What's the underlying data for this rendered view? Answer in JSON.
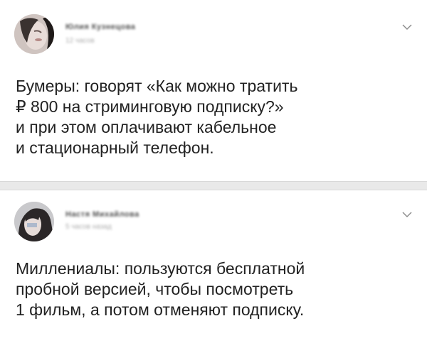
{
  "posts": [
    {
      "author_name": "Юлия Кузнецова",
      "author_date": "12 часов",
      "text_lines": [
        "Бумеры: говорят «Как можно тратить",
        "₽ 800 на стриминговую подписку?»",
        "и при этом оплачивают кабельное",
        "и стационарный телефон."
      ]
    },
    {
      "author_name": "Настя Михайлова",
      "author_date": "5 часов назад",
      "text_lines": [
        "Миллениалы: пользуются бесплатной",
        "пробной версией, чтобы посмотреть",
        "1 фильм, а потом отменяют подписку."
      ]
    }
  ],
  "icons": {
    "menu": "chevron-down-icon"
  },
  "colors": {
    "background": "#ffffff",
    "divider": "#e9e9e9",
    "text": "#222222"
  }
}
